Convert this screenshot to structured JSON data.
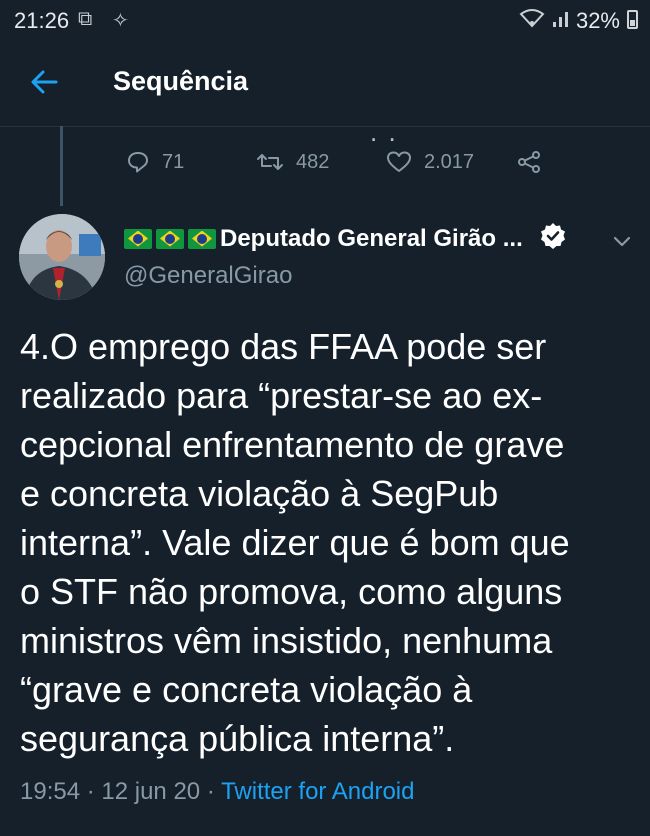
{
  "status_bar": {
    "time": "21:26",
    "battery": "32%"
  },
  "header": {
    "title": "Sequência"
  },
  "previous_tweet": {
    "partial_text": ". .",
    "replies": "71",
    "retweets": "482",
    "likes": "2.017"
  },
  "tweet": {
    "author_flags": "🇧🇷🇧🇷🇧🇷",
    "author_name": "Deputado General Girão ...",
    "handle": "@GeneralGirao",
    "text": "4.O emprego das FFAA pode ser\nrealizado para “prestar-se ao ex-\ncepcional enfrentamento de grave\ne concreta violação à SegPub\ninterna”. Vale dizer que é bom que\no STF não promova, como alguns\nministros vêm insistido, nenhuma\n“grave e concreta violação à\nsegurança pública interna”.",
    "time": "19:54",
    "separator": " · ",
    "date": "12 jun 20",
    "source": "Twitter for Android"
  },
  "colors": {
    "background": "#15202b",
    "accent": "#1da1f2",
    "secondary_text": "#8899a6"
  },
  "icons": [
    "back-arrow-icon",
    "reply-icon",
    "retweet-icon",
    "like-icon",
    "share-icon",
    "verified-badge-icon",
    "chevron-down-icon"
  ]
}
